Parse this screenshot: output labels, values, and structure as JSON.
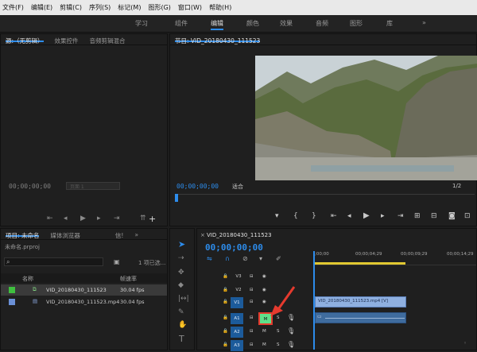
{
  "menu": [
    "文件(F)",
    "编辑(E)",
    "剪辑(C)",
    "序列(S)",
    "标记(M)",
    "图形(G)",
    "窗口(W)",
    "帮助(H)"
  ],
  "workspaces": [
    "学习",
    "组件",
    "编辑",
    "颜色",
    "效果",
    "音频",
    "图形",
    "库",
    "»"
  ],
  "source": {
    "tab1": "源:（无剪辑）",
    "tab2": "效果控件",
    "tab3": "音频剪辑混合",
    "timecode": "00;00;00;00",
    "page": "页面 1"
  },
  "program": {
    "title": "节目: VID_20180430_111523",
    "timecode": "00;00;00;00",
    "fit": "适合",
    "ratio": "1/2"
  },
  "project": {
    "tab": "项目: 未命名",
    "tab2": "媒体浏览器",
    "tab3": "信!",
    "more": "»",
    "file": "未命名.prproj",
    "selected": "1 项已选...",
    "col_name": "名称",
    "col_rate": "帧速率",
    "items": [
      {
        "name": "VID_20180430_111523",
        "rate": "30.04 fps"
      },
      {
        "name": "VID_20180430_111523.mp4",
        "rate": "30.04 fps"
      }
    ]
  },
  "timeline": {
    "tab": "VID_20180430_111523",
    "timecode": "00;00;00;00",
    "ticks": [
      ";00;00",
      "00;00;04;29",
      "00;00;09;29",
      "00;00;14;29",
      "00;0"
    ],
    "tracks": [
      "V3",
      "V2",
      "V1",
      "A1",
      "A2",
      "A3"
    ],
    "clip_label": "VID_20180430_111523.mp4 [V]",
    "m_label": "M",
    "s_label": "S",
    "target_v": "V1",
    "target_a": "A1"
  },
  "colors": {
    "accent": "#2d8ceb",
    "highlight_button": "#5fe08a"
  }
}
